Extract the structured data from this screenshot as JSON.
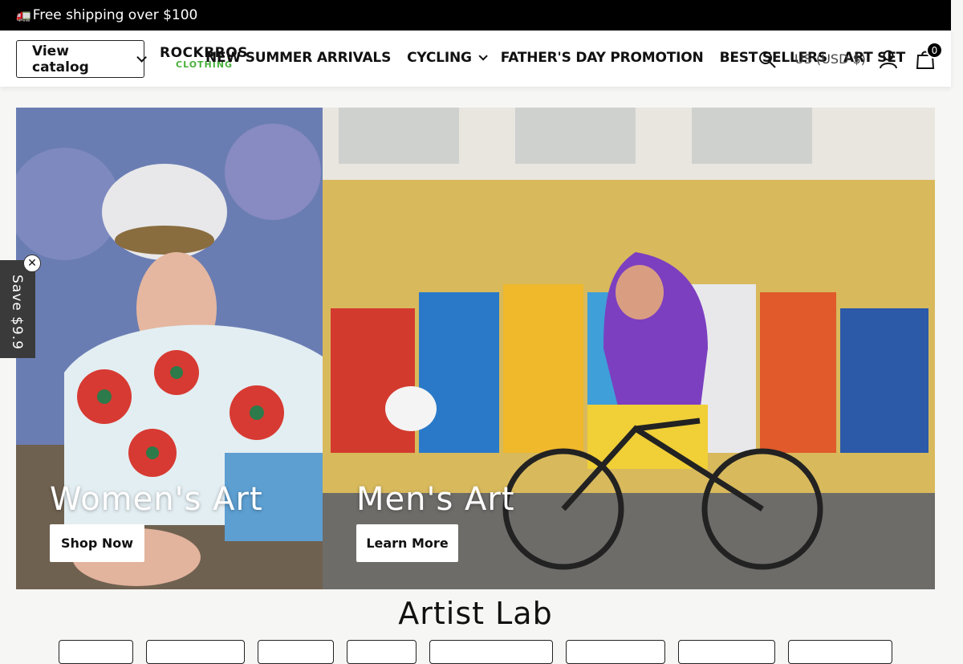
{
  "announcement": {
    "icon": "truck-icon",
    "text": "Free shipping over $100"
  },
  "header": {
    "catalog_button": "View catalog",
    "logo": {
      "line1": "ROCKBROS",
      "line2": "CLOTHING"
    },
    "nav": [
      {
        "label": "NEW SUMMER ARRIVALS"
      },
      {
        "label": "CYCLING",
        "dropdown": true
      },
      {
        "label": "FATHER'S DAY PROMOTION"
      },
      {
        "label": "BEST SELLERS"
      },
      {
        "label": "ART SET"
      }
    ],
    "currency": "US (USD $)",
    "cart_count": "0"
  },
  "heroes": {
    "womens": {
      "title": "Women's Art",
      "button": "Shop Now"
    },
    "mens": {
      "title": "Men's Art",
      "button": "Learn More"
    }
  },
  "save_tab": {
    "text": "Save $9.9"
  },
  "section": {
    "title": "Artist Lab"
  },
  "colors": {
    "brand_green": "#48b13c",
    "announcement_bg": "#000000"
  }
}
